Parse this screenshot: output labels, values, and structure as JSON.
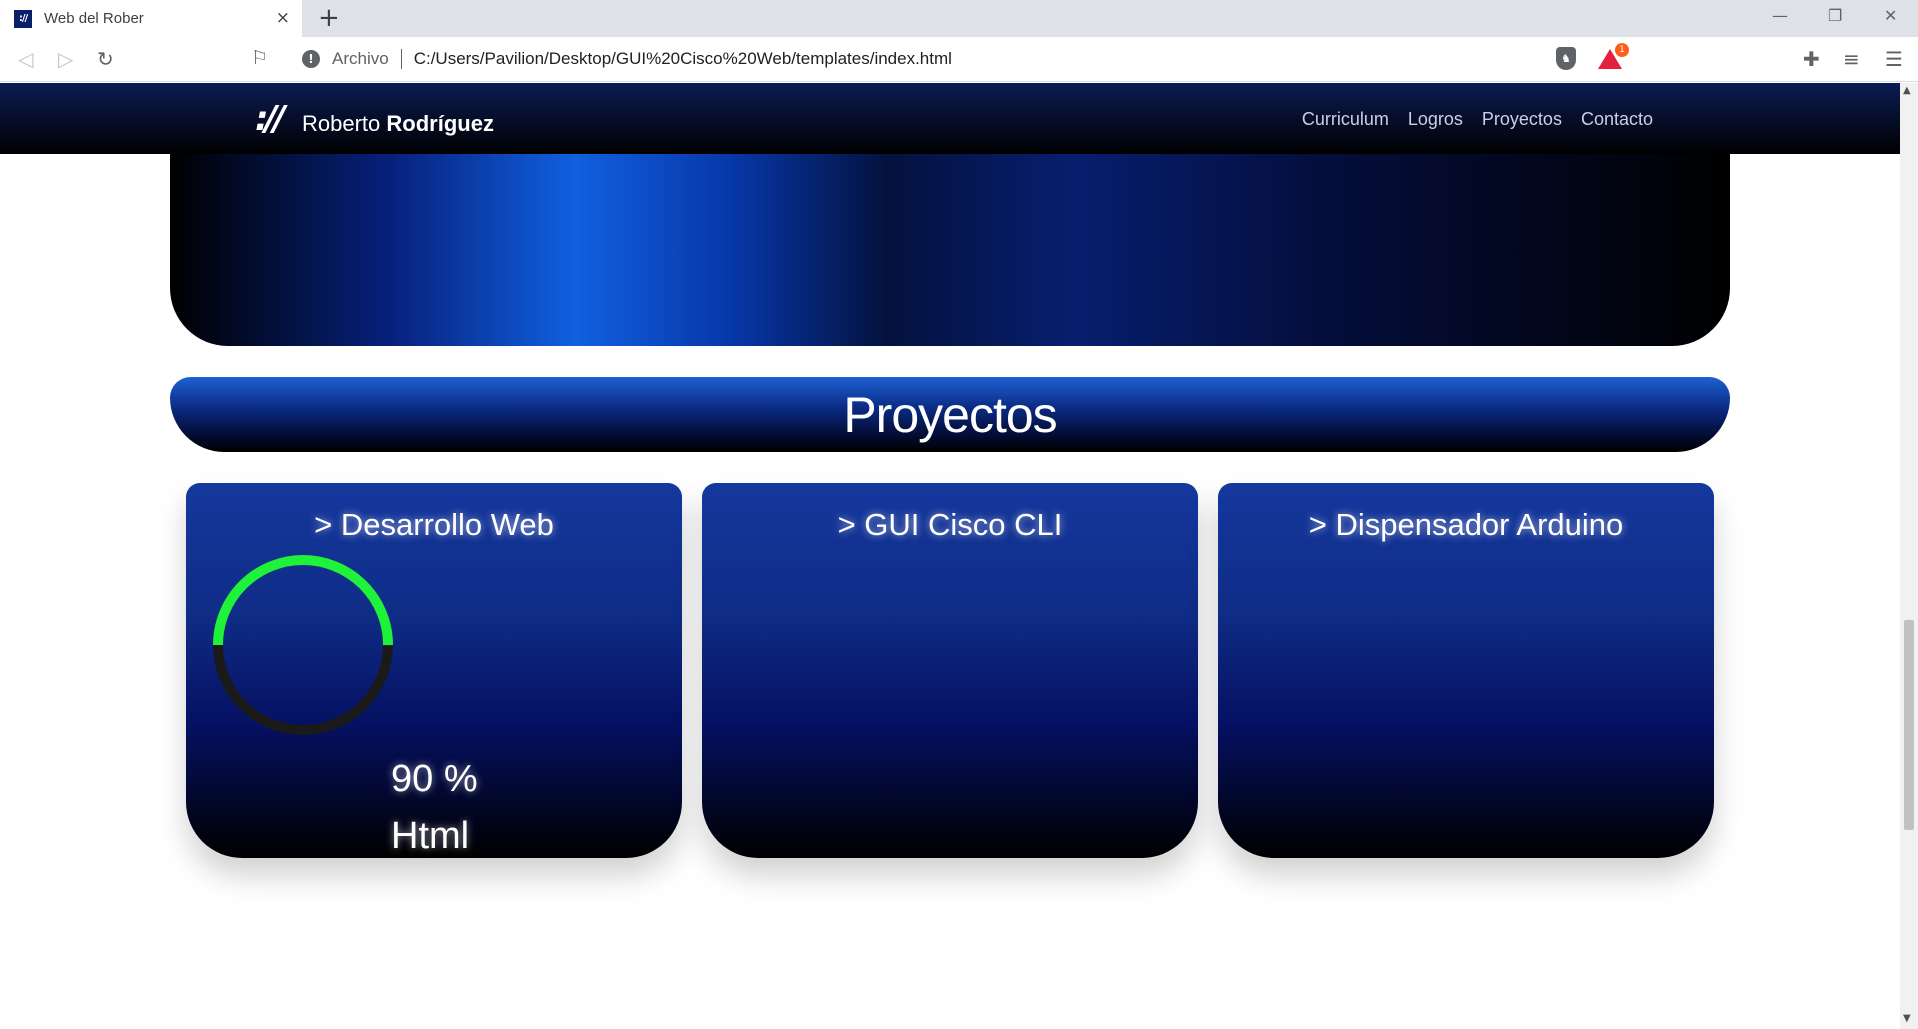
{
  "browser": {
    "tab_title": "Web del Rober",
    "tab_favicon": "://",
    "tab_close": "×",
    "new_tab": "+",
    "window_controls": [
      "—",
      "❐",
      "✕"
    ],
    "scheme_label": "Archivo",
    "url": "C:/Users/Pavilion/Desktop/GUI%20Cisco%20Web/templates/index.html",
    "rewards_badge": "1",
    "icons": [
      "back-icon",
      "forward-icon",
      "reload-icon",
      "bookmark-icon",
      "info-icon",
      "brave-shield-icon",
      "brave-rewards-icon",
      "extensions-icon",
      "playlist-icon",
      "menu-icon"
    ]
  },
  "site": {
    "logo_mark": "://",
    "logo_first": "Roberto",
    "logo_last": "Rodríguez",
    "nav": [
      "Curriculum",
      "Logros",
      "Proyectos",
      "Contacto"
    ]
  },
  "projects": {
    "title": "Proyectos",
    "cards": [
      {
        "title": "> Desarrollo Web",
        "gauge_value": "90 %",
        "gauge_label": "Html",
        "gauge_fraction": 0.5
      },
      {
        "title": "> GUI Cisco CLI"
      },
      {
        "title": "> Dispensador Arduino"
      }
    ]
  },
  "colors": {
    "gauge_progress": "#1ef23a",
    "gauge_track": "#1a1a1a",
    "nav_bg": "#050c26",
    "card_top": "#15389e"
  }
}
